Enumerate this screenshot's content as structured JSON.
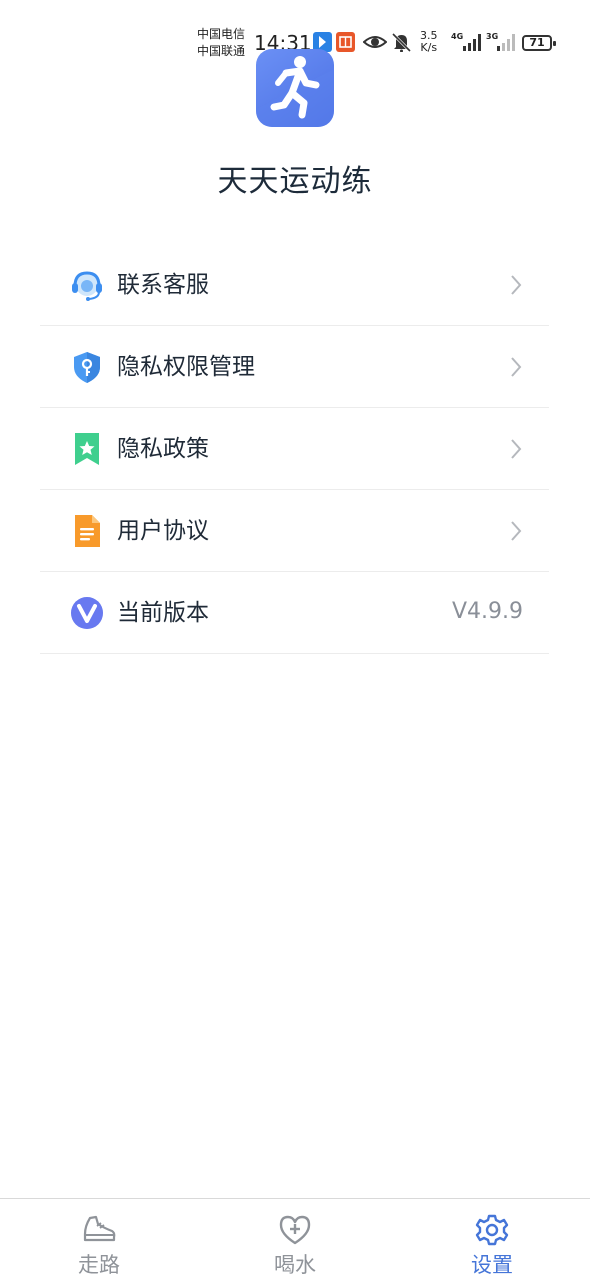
{
  "status_bar": {
    "carrier_1": "中国电信",
    "carrier_2": "中国联通",
    "time": "14:31",
    "net_speed_value": "3.5",
    "net_speed_unit": "K/s",
    "signal_1_label": "4G",
    "signal_2_label": "3G",
    "battery": "71"
  },
  "app": {
    "title": "天天运动练"
  },
  "menu": {
    "items": [
      {
        "label": "联系客服",
        "icon": "headset-icon"
      },
      {
        "label": "隐私权限管理",
        "icon": "shield-key-icon"
      },
      {
        "label": "隐私政策",
        "icon": "bookmark-star-icon"
      },
      {
        "label": "用户协议",
        "icon": "document-icon"
      },
      {
        "label": "当前版本",
        "icon": "version-v-icon",
        "value": "V4.9.9"
      }
    ]
  },
  "bottom_nav": {
    "tabs": [
      {
        "label": "走路",
        "icon": "shoe-icon",
        "active": false
      },
      {
        "label": "喝水",
        "icon": "heart-plus-icon",
        "active": false
      },
      {
        "label": "设置",
        "icon": "gear-icon",
        "active": true
      }
    ]
  },
  "colors": {
    "accent": "#4575d8",
    "inactive": "#8f9399"
  }
}
